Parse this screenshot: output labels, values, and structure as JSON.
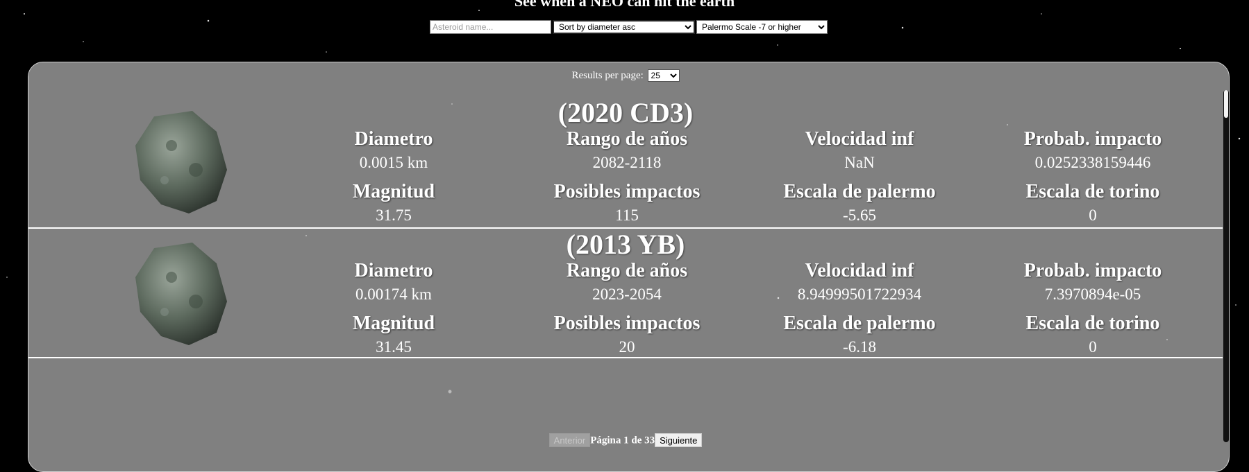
{
  "page": {
    "title": "See when a NEO can hit the earth"
  },
  "filters": {
    "name_placeholder": "Asteroid name...",
    "sort_selected": "Sort by diameter asc",
    "scale_selected": "Palermo Scale -7 or higher"
  },
  "pagination": {
    "results_label": "Results per page:",
    "per_page": "25",
    "prev_label": "Anterior",
    "page_info": "Página 1 de 33",
    "next_label": "Siguiente"
  },
  "neos": [
    {
      "name": "(2020 CD3)",
      "diameter_label": "Diametro",
      "diameter": "0.0015 km",
      "years_label": "Rango de años",
      "years": "2082-2118",
      "velocity_label": "Velocidad inf",
      "velocity": "NaN",
      "prob_label": "Probab. impacto",
      "prob": "0.0252338159446",
      "mag_label": "Magnitud",
      "mag": "31.75",
      "impacts_label": "Posibles impactos",
      "impacts": "115",
      "palermo_label": "Escala de palermo",
      "palermo": "-5.65",
      "torino_label": "Escala de torino",
      "torino": "0"
    },
    {
      "name": "(2013 YB)",
      "diameter_label": "Diametro",
      "diameter": "0.00174 km",
      "years_label": "Rango de años",
      "years": "2023-2054",
      "velocity_label": "Velocidad inf",
      "velocity": "8.94999501722934",
      "prob_label": "Probab. impacto",
      "prob": "7.3970894e-05",
      "mag_label": "Magnitud",
      "mag": "31.45",
      "impacts_label": "Posibles impactos",
      "impacts": "20",
      "palermo_label": "Escala de palermo",
      "palermo": "-6.18",
      "torino_label": "Escala de torino",
      "torino": "0"
    }
  ],
  "colors": {
    "panel": "#808080",
    "background": "#000000"
  }
}
